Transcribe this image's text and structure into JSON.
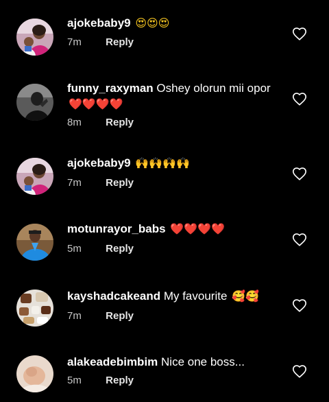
{
  "comments": [
    {
      "username": "ajokebaby9",
      "text": "",
      "emoji": "😍😍😍",
      "emoji_color": "#ffcc22",
      "time": "7m",
      "reply": "Reply",
      "avatar": "avatar-photo-woman-child"
    },
    {
      "username": "funny_raxyman",
      "text": "Oshey olorun mii opor",
      "emoji": "❤️❤️❤️❤️",
      "emoji_color": "#ef1e3a",
      "time": "8m",
      "reply": "Reply",
      "avatar": "avatar-photo-man-bw"
    },
    {
      "username": "ajokebaby9",
      "text": "",
      "emoji": "🙌🙌🙌🙌",
      "emoji_color": "#f6c21a",
      "time": "7m",
      "reply": "Reply",
      "avatar": "avatar-photo-woman-child"
    },
    {
      "username": "motunrayor_babs",
      "text": "",
      "emoji": "❤️❤️❤️❤️",
      "emoji_color": "#ef1e3a",
      "time": "5m",
      "reply": "Reply",
      "avatar": "avatar-photo-man-blue"
    },
    {
      "username": "kayshadcakeand",
      "text": "My favourite",
      "emoji": "🥰🥰",
      "emoji_color": "#ffcc22",
      "time": "7m",
      "reply": "Reply",
      "avatar": "avatar-photo-cakes"
    },
    {
      "username": "alakeadebimbim",
      "text": "Nice one boss...",
      "emoji": "",
      "emoji_color": "#ffffff",
      "time": "5m",
      "reply": "Reply",
      "avatar": "avatar-photo-baby"
    }
  ],
  "icons": {
    "like": "heart-outline-icon"
  },
  "colors": {
    "background": "#000000",
    "text": "#ffffff",
    "meta": "#c8c8c8"
  }
}
